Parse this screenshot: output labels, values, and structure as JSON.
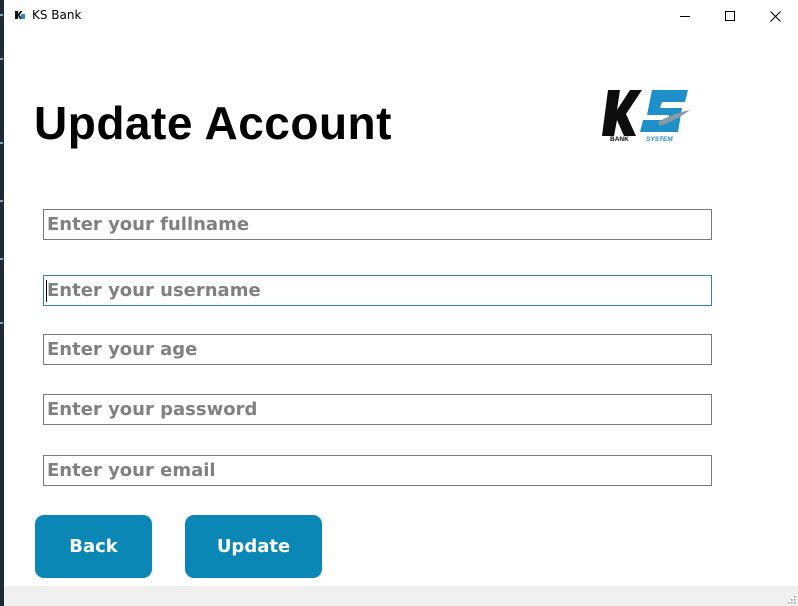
{
  "window": {
    "title": "KS Bank",
    "controls": {
      "minimize": "minimize",
      "maximize": "maximize",
      "close": "close"
    }
  },
  "page": {
    "title": "Update Account"
  },
  "logo": {
    "letters": "KS",
    "subtitle_left": "BANK",
    "subtitle_right": "SYSTEM"
  },
  "form": {
    "fullname": {
      "placeholder": "Enter your fullname",
      "value": ""
    },
    "username": {
      "placeholder": "Enter your username",
      "value": ""
    },
    "age": {
      "placeholder": "Enter your age",
      "value": ""
    },
    "password": {
      "placeholder": "Enter your password",
      "value": ""
    },
    "email": {
      "placeholder": "Enter your email",
      "value": ""
    }
  },
  "buttons": {
    "back": "Back",
    "update": "Update"
  },
  "colors": {
    "accent": "#0a87b5",
    "logo_blue": "#1e8fc9",
    "focus_border": "#2e8b94"
  }
}
